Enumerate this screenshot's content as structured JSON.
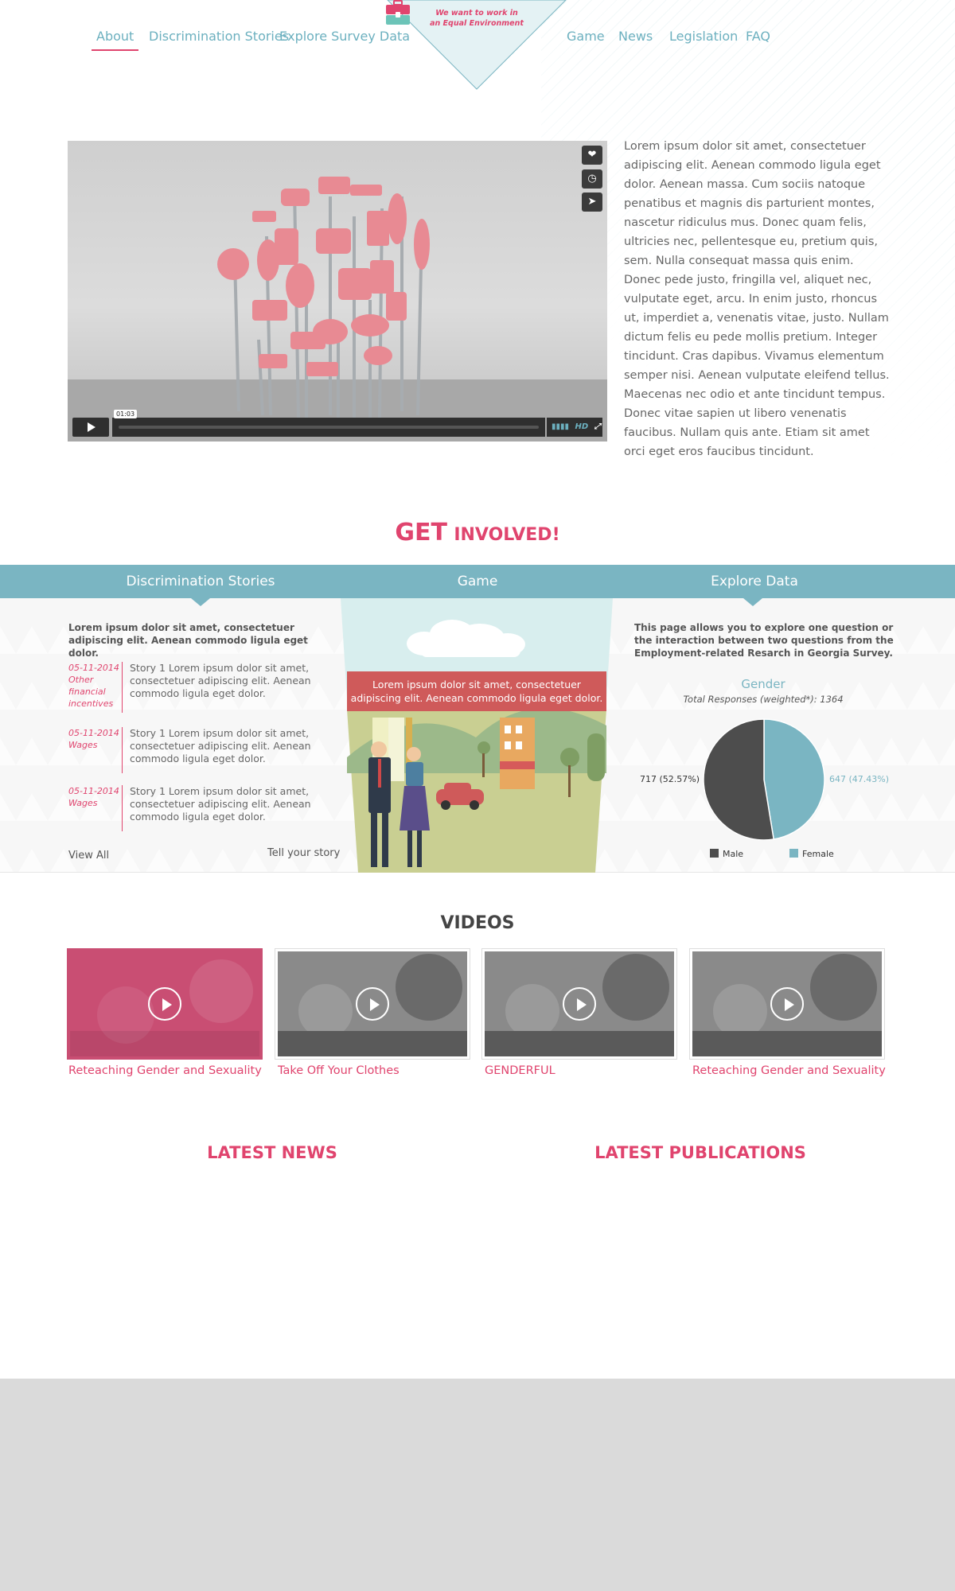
{
  "nav": {
    "left": [
      {
        "label": "About",
        "active": true
      },
      {
        "label": "Discrimination Stories"
      },
      {
        "label": "Explore Survey Data"
      }
    ],
    "right": [
      {
        "label": "Game"
      },
      {
        "label": "News"
      },
      {
        "label": "Legislation"
      },
      {
        "label": "FAQ"
      }
    ],
    "badge_line1": "We want to work in",
    "badge_line2": "an Equal Environment"
  },
  "intro": {
    "video_time": "01:03",
    "video_quality": "HD",
    "text": "Lorem ipsum dolor sit amet, consectetuer adipiscing elit. Aenean commodo ligula eget dolor. Aenean massa. Cum sociis natoque penatibus et magnis dis parturient montes, nascetur ridiculus mus. Donec quam felis, ultricies nec, pellentesque eu, pretium quis, sem. Nulla consequat massa quis enim. Donec pede justo, fringilla vel, aliquet nec, vulputate eget, arcu. In enim justo, rhoncus ut, imperdiet a, venenatis vitae, justo. Nullam dictum felis eu pede mollis pretium. Integer tincidunt. Cras dapibus. Vivamus elementum semper nisi. Aenean vulputate eleifend tellus. Maecenas nec odio et ante tincidunt tempus. Donec vitae sapien ut libero venenatis faucibus. Nullam quis ante. Etiam sit amet orci eget eros faucibus tincidunt."
  },
  "get_involved": {
    "title_bold": "GET",
    "title_rest": "INVOLVED!",
    "tabs": [
      "Discrimination Stories",
      "Game",
      "Explore Data"
    ],
    "stories_lead": "Lorem ipsum dolor sit amet, consectetuer adipiscing elit. Aenean commodo ligula eget dolor.",
    "stories": [
      {
        "date": "05-11-2014",
        "category": "Other financial incentives",
        "text": "Story 1 Lorem ipsum dolor sit amet, consectetuer adipiscing elit. Aenean commodo ligula eget dolor."
      },
      {
        "date": "05-11-2014",
        "category": "Wages",
        "text": "Story 1 Lorem ipsum dolor sit amet, consectetuer adipiscing elit. Aenean commodo ligula eget dolor."
      },
      {
        "date": "05-11-2014",
        "category": "Wages",
        "text": "Story 1 Lorem ipsum dolor sit amet, consectetuer adipiscing elit. Aenean commodo ligula eget dolor."
      }
    ],
    "view_all": "View All",
    "tell_story": "Tell your story",
    "game_caption": "Lorem ipsum dolor sit amet, consectetuer adipiscing elit. Aenean commodo ligula eget dolor.",
    "data_lead": "This page allows you to explore one question or the interaction between two questions from the Employment-related Resarch in Georgia Survey."
  },
  "chart_data": {
    "type": "pie",
    "title": "Gender",
    "subtitle": "Total Responses (weighted*): 1364",
    "slices": [
      {
        "name": "Male",
        "value": 717,
        "label": "717 (52.57%)",
        "color": "#4d4d4d"
      },
      {
        "name": "Female",
        "value": 647,
        "label": "647 (47.43%)",
        "color": "#7ab5c2"
      }
    ],
    "legend_position": "bottom"
  },
  "videos": {
    "title": "VIDEOS",
    "items": [
      {
        "title": "Reteaching Gender and Sexuality",
        "active": true
      },
      {
        "title": "Take Off Your Clothes"
      },
      {
        "title": "GENDERFUL"
      },
      {
        "title": "Reteaching Gender and Sexuality"
      }
    ]
  },
  "latest": {
    "news_title": "LATEST NEWS",
    "publications_title": "LATEST PUBLICATIONS"
  },
  "colors": {
    "accent": "#e0446e",
    "teal": "#7ab5c2",
    "footer": "#dadada"
  }
}
